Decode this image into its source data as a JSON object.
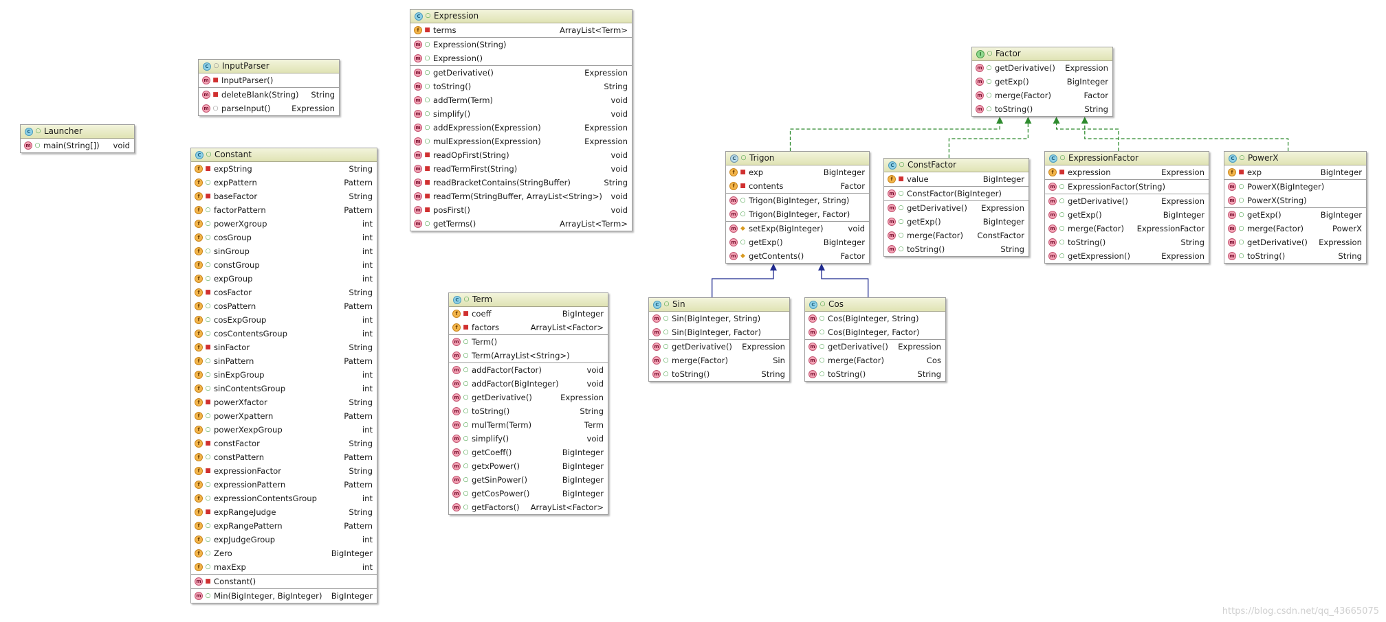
{
  "classes": [
    {
      "id": "launcher",
      "name": "Launcher",
      "kind": "class-run",
      "sections": [
        [
          {
            "name": "main(String[])",
            "type": "void",
            "icon": "method",
            "vis": "public"
          }
        ]
      ]
    },
    {
      "id": "inputparser",
      "name": "InputParser",
      "kind": "class",
      "nameVis": "package",
      "sections": [
        [
          {
            "name": "InputParser()",
            "type": "",
            "icon": "method",
            "vis": "private"
          }
        ],
        [
          {
            "name": "deleteBlank(String)",
            "type": "String",
            "icon": "method",
            "vis": "private"
          },
          {
            "name": "parseInput()",
            "type": "Expression",
            "icon": "method",
            "vis": "package"
          }
        ]
      ]
    },
    {
      "id": "constant",
      "name": "Constant",
      "kind": "class",
      "sections": [
        [
          {
            "name": "expString",
            "type": "String",
            "icon": "field",
            "vis": "private"
          },
          {
            "name": "expPattern",
            "type": "Pattern",
            "icon": "field",
            "vis": "public"
          },
          {
            "name": "baseFactor",
            "type": "String",
            "icon": "field",
            "vis": "private"
          },
          {
            "name": "factorPattern",
            "type": "Pattern",
            "icon": "field",
            "vis": "public"
          },
          {
            "name": "powerXgroup",
            "type": "int",
            "icon": "field",
            "vis": "public"
          },
          {
            "name": "cosGroup",
            "type": "int",
            "icon": "field",
            "vis": "public"
          },
          {
            "name": "sinGroup",
            "type": "int",
            "icon": "field",
            "vis": "public"
          },
          {
            "name": "constGroup",
            "type": "int",
            "icon": "field",
            "vis": "public"
          },
          {
            "name": "expGroup",
            "type": "int",
            "icon": "field",
            "vis": "public"
          },
          {
            "name": "cosFactor",
            "type": "String",
            "icon": "field",
            "vis": "private"
          },
          {
            "name": "cosPattern",
            "type": "Pattern",
            "icon": "field",
            "vis": "public"
          },
          {
            "name": "cosExpGroup",
            "type": "int",
            "icon": "field",
            "vis": "public"
          },
          {
            "name": "cosContentsGroup",
            "type": "int",
            "icon": "field",
            "vis": "public"
          },
          {
            "name": "sinFactor",
            "type": "String",
            "icon": "field",
            "vis": "private"
          },
          {
            "name": "sinPattern",
            "type": "Pattern",
            "icon": "field",
            "vis": "public"
          },
          {
            "name": "sinExpGroup",
            "type": "int",
            "icon": "field",
            "vis": "public"
          },
          {
            "name": "sinContentsGroup",
            "type": "int",
            "icon": "field",
            "vis": "public"
          },
          {
            "name": "powerXfactor",
            "type": "String",
            "icon": "field",
            "vis": "private"
          },
          {
            "name": "powerXpattern",
            "type": "Pattern",
            "icon": "field",
            "vis": "public"
          },
          {
            "name": "powerXexpGroup",
            "type": "int",
            "icon": "field",
            "vis": "public"
          },
          {
            "name": "constFactor",
            "type": "String",
            "icon": "field",
            "vis": "private"
          },
          {
            "name": "constPattern",
            "type": "Pattern",
            "icon": "field",
            "vis": "public"
          },
          {
            "name": "expressionFactor",
            "type": "String",
            "icon": "field",
            "vis": "private"
          },
          {
            "name": "expressionPattern",
            "type": "Pattern",
            "icon": "field",
            "vis": "public"
          },
          {
            "name": "expressionContentsGroup",
            "type": "int",
            "icon": "field",
            "vis": "public"
          },
          {
            "name": "expRangeJudge",
            "type": "String",
            "icon": "field",
            "vis": "private"
          },
          {
            "name": "expRangePattern",
            "type": "Pattern",
            "icon": "field",
            "vis": "public"
          },
          {
            "name": "expJudgeGroup",
            "type": "int",
            "icon": "field",
            "vis": "public"
          },
          {
            "name": "Zero",
            "type": "BigInteger",
            "icon": "field",
            "vis": "public"
          },
          {
            "name": "maxExp",
            "type": "int",
            "icon": "field",
            "vis": "public"
          }
        ],
        [
          {
            "name": "Constant()",
            "type": "",
            "icon": "method",
            "vis": "private"
          }
        ],
        [
          {
            "name": "Min(BigInteger, BigInteger)",
            "type": "BigInteger",
            "icon": "method",
            "vis": "public"
          }
        ]
      ]
    },
    {
      "id": "expression",
      "name": "Expression",
      "kind": "class",
      "sections": [
        [
          {
            "name": "terms",
            "type": "ArrayList<Term>",
            "icon": "field",
            "vis": "private"
          }
        ],
        [
          {
            "name": "Expression(String)",
            "type": "",
            "icon": "method",
            "vis": "public"
          },
          {
            "name": "Expression()",
            "type": "",
            "icon": "method",
            "vis": "public"
          }
        ],
        [
          {
            "name": "getDerivative()",
            "type": "Expression",
            "icon": "method",
            "vis": "public"
          },
          {
            "name": "toString()",
            "type": "String",
            "icon": "method",
            "vis": "public"
          },
          {
            "name": "addTerm(Term)",
            "type": "void",
            "icon": "method",
            "vis": "public"
          },
          {
            "name": "simplify()",
            "type": "void",
            "icon": "method",
            "vis": "public"
          },
          {
            "name": "addExpression(Expression)",
            "type": "Expression",
            "icon": "method",
            "vis": "public"
          },
          {
            "name": "mulExpression(Expression)",
            "type": "Expression",
            "icon": "method",
            "vis": "public"
          },
          {
            "name": "readOpFirst(String)",
            "type": "void",
            "icon": "method",
            "vis": "private"
          },
          {
            "name": "readTermFirst(String)",
            "type": "void",
            "icon": "method",
            "vis": "private"
          },
          {
            "name": "readBracketContains(StringBuffer)",
            "type": "String",
            "icon": "method",
            "vis": "private"
          },
          {
            "name": "readTerm(StringBuffer, ArrayList<String>)",
            "type": "void",
            "icon": "method",
            "vis": "private"
          },
          {
            "name": "posFirst()",
            "type": "void",
            "icon": "method",
            "vis": "private"
          },
          {
            "name": "getTerms()",
            "type": "ArrayList<Term>",
            "icon": "method",
            "vis": "public"
          }
        ]
      ]
    },
    {
      "id": "term",
      "name": "Term",
      "kind": "class",
      "sections": [
        [
          {
            "name": "coeff",
            "type": "BigInteger",
            "icon": "field",
            "vis": "private"
          },
          {
            "name": "factors",
            "type": "ArrayList<Factor>",
            "icon": "field",
            "vis": "private"
          }
        ],
        [
          {
            "name": "Term()",
            "type": "",
            "icon": "method",
            "vis": "public"
          },
          {
            "name": "Term(ArrayList<String>)",
            "type": "",
            "icon": "method",
            "vis": "public"
          }
        ],
        [
          {
            "name": "addFactor(Factor)",
            "type": "void",
            "icon": "method",
            "vis": "public"
          },
          {
            "name": "addFactor(BigInteger)",
            "type": "void",
            "icon": "method",
            "vis": "public"
          },
          {
            "name": "getDerivative()",
            "type": "Expression",
            "icon": "method",
            "vis": "public"
          },
          {
            "name": "toString()",
            "type": "String",
            "icon": "method",
            "vis": "public"
          },
          {
            "name": "mulTerm(Term)",
            "type": "Term",
            "icon": "method",
            "vis": "public"
          },
          {
            "name": "simplify()",
            "type": "void",
            "icon": "method",
            "vis": "public"
          },
          {
            "name": "getCoeff()",
            "type": "BigInteger",
            "icon": "method",
            "vis": "public"
          },
          {
            "name": "getxPower()",
            "type": "BigInteger",
            "icon": "method",
            "vis": "public"
          },
          {
            "name": "getSinPower()",
            "type": "BigInteger",
            "icon": "method",
            "vis": "public"
          },
          {
            "name": "getCosPower()",
            "type": "BigInteger",
            "icon": "method",
            "vis": "public"
          },
          {
            "name": "getFactors()",
            "type": "ArrayList<Factor>",
            "icon": "method",
            "vis": "public"
          }
        ]
      ]
    },
    {
      "id": "factor",
      "name": "Factor",
      "kind": "interface",
      "sections": [
        [
          {
            "name": "getDerivative()",
            "type": "Expression",
            "icon": "method",
            "vis": "public"
          },
          {
            "name": "getExp()",
            "type": "BigInteger",
            "icon": "method",
            "vis": "public"
          },
          {
            "name": "merge(Factor)",
            "type": "Factor",
            "icon": "method",
            "vis": "public"
          },
          {
            "name": "toString()",
            "type": "String",
            "icon": "method",
            "vis": "public"
          }
        ]
      ]
    },
    {
      "id": "trigon",
      "name": "Trigon",
      "kind": "abstract",
      "sections": [
        [
          {
            "name": "exp",
            "type": "BigInteger",
            "icon": "field",
            "vis": "private"
          },
          {
            "name": "contents",
            "type": "Factor",
            "icon": "field",
            "vis": "private"
          }
        ],
        [
          {
            "name": "Trigon(BigInteger, String)",
            "type": "",
            "icon": "method",
            "vis": "public"
          },
          {
            "name": "Trigon(BigInteger, Factor)",
            "type": "",
            "icon": "method",
            "vis": "public"
          }
        ],
        [
          {
            "name": "setExp(BigInteger)",
            "type": "void",
            "icon": "method",
            "vis": "protected"
          },
          {
            "name": "getExp()",
            "type": "BigInteger",
            "icon": "method",
            "vis": "public"
          },
          {
            "name": "getContents()",
            "type": "Factor",
            "icon": "method",
            "vis": "protected"
          }
        ]
      ]
    },
    {
      "id": "constfactor",
      "name": "ConstFactor",
      "kind": "class",
      "sections": [
        [
          {
            "name": "value",
            "type": "BigInteger",
            "icon": "field",
            "vis": "private"
          }
        ],
        [
          {
            "name": "ConstFactor(BigInteger)",
            "type": "",
            "icon": "method",
            "vis": "public"
          }
        ],
        [
          {
            "name": "getDerivative()",
            "type": "Expression",
            "icon": "method",
            "vis": "public"
          },
          {
            "name": "getExp()",
            "type": "BigInteger",
            "icon": "method",
            "vis": "public"
          },
          {
            "name": "merge(Factor)",
            "type": "ConstFactor",
            "icon": "method",
            "vis": "public"
          },
          {
            "name": "toString()",
            "type": "String",
            "icon": "method",
            "vis": "public"
          }
        ]
      ]
    },
    {
      "id": "expressionfactor",
      "name": "ExpressionFactor",
      "kind": "class",
      "sections": [
        [
          {
            "name": "expression",
            "type": "Expression",
            "icon": "field",
            "vis": "private"
          }
        ],
        [
          {
            "name": "ExpressionFactor(String)",
            "type": "",
            "icon": "method",
            "vis": "public"
          }
        ],
        [
          {
            "name": "getDerivative()",
            "type": "Expression",
            "icon": "method",
            "vis": "public"
          },
          {
            "name": "getExp()",
            "type": "BigInteger",
            "icon": "method",
            "vis": "public"
          },
          {
            "name": "merge(Factor)",
            "type": "ExpressionFactor",
            "icon": "method",
            "vis": "public"
          },
          {
            "name": "toString()",
            "type": "String",
            "icon": "method",
            "vis": "public"
          },
          {
            "name": "getExpression()",
            "type": "Expression",
            "icon": "method",
            "vis": "public"
          }
        ]
      ]
    },
    {
      "id": "powerx",
      "name": "PowerX",
      "kind": "class",
      "sections": [
        [
          {
            "name": "exp",
            "type": "BigInteger",
            "icon": "field",
            "vis": "private"
          }
        ],
        [
          {
            "name": "PowerX(BigInteger)",
            "type": "",
            "icon": "method",
            "vis": "public"
          },
          {
            "name": "PowerX(String)",
            "type": "",
            "icon": "method",
            "vis": "public"
          }
        ],
        [
          {
            "name": "getExp()",
            "type": "BigInteger",
            "icon": "method",
            "vis": "public"
          },
          {
            "name": "merge(Factor)",
            "type": "PowerX",
            "icon": "method",
            "vis": "public"
          },
          {
            "name": "getDerivative()",
            "type": "Expression",
            "icon": "method",
            "vis": "public"
          },
          {
            "name": "toString()",
            "type": "String",
            "icon": "method",
            "vis": "public"
          }
        ]
      ]
    },
    {
      "id": "sin",
      "name": "Sin",
      "kind": "class",
      "sections": [
        [
          {
            "name": "Sin(BigInteger, String)",
            "type": "",
            "icon": "method",
            "vis": "public"
          },
          {
            "name": "Sin(BigInteger, Factor)",
            "type": "",
            "icon": "method",
            "vis": "public"
          }
        ],
        [
          {
            "name": "getDerivative()",
            "type": "Expression",
            "icon": "method",
            "vis": "public"
          },
          {
            "name": "merge(Factor)",
            "type": "Sin",
            "icon": "method",
            "vis": "public"
          },
          {
            "name": "toString()",
            "type": "String",
            "icon": "method",
            "vis": "public"
          }
        ]
      ]
    },
    {
      "id": "cos",
      "name": "Cos",
      "kind": "class",
      "sections": [
        [
          {
            "name": "Cos(BigInteger, String)",
            "type": "",
            "icon": "method",
            "vis": "public"
          },
          {
            "name": "Cos(BigInteger, Factor)",
            "type": "",
            "icon": "method",
            "vis": "public"
          }
        ],
        [
          {
            "name": "getDerivative()",
            "type": "Expression",
            "icon": "method",
            "vis": "public"
          },
          {
            "name": "merge(Factor)",
            "type": "Cos",
            "icon": "method",
            "vis": "public"
          },
          {
            "name": "toString()",
            "type": "String",
            "icon": "method",
            "vis": "public"
          }
        ]
      ]
    }
  ],
  "relations": [
    {
      "from": "trigon",
      "to": "factor",
      "kind": "implements"
    },
    {
      "from": "constfactor",
      "to": "factor",
      "kind": "implements"
    },
    {
      "from": "expressionfactor",
      "to": "factor",
      "kind": "implements"
    },
    {
      "from": "powerx",
      "to": "factor",
      "kind": "implements"
    },
    {
      "from": "sin",
      "to": "trigon",
      "kind": "extends"
    },
    {
      "from": "cos",
      "to": "trigon",
      "kind": "extends"
    }
  ],
  "colors": {
    "implements": "#2e8b2e",
    "extends": "#1f2a8f"
  },
  "watermark": "https://blog.csdn.net/qq_43665075"
}
